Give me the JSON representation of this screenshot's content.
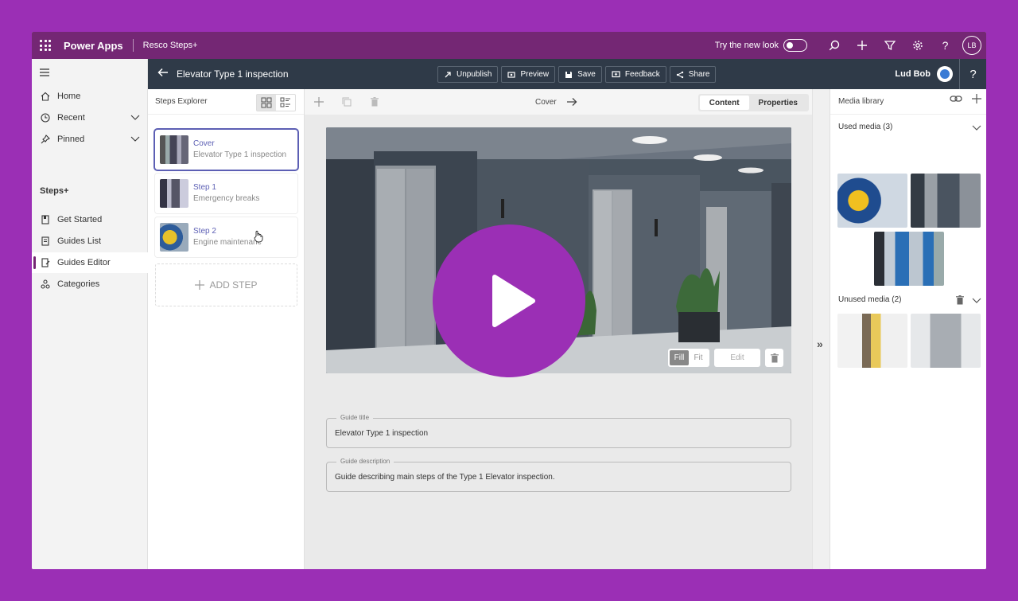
{
  "suite": {
    "app_name": "Power Apps",
    "env_name": "Resco Steps+",
    "try_new_look": "Try the new look",
    "avatar_initials": "LB"
  },
  "nav": {
    "items": [
      {
        "label": "Home"
      },
      {
        "label": "Recent"
      },
      {
        "label": "Pinned"
      }
    ],
    "section": "Steps+",
    "section_items": [
      {
        "label": "Get Started"
      },
      {
        "label": "Guides List"
      },
      {
        "label": "Guides Editor"
      },
      {
        "label": "Categories"
      }
    ]
  },
  "command_bar": {
    "title": "Elevator Type 1 inspection",
    "buttons": [
      {
        "label": "Unpublish"
      },
      {
        "label": "Preview"
      },
      {
        "label": "Save"
      },
      {
        "label": "Feedback"
      },
      {
        "label": "Share"
      }
    ],
    "user_name": "Lud Bob",
    "help": "?"
  },
  "steps_explorer": {
    "title": "Steps Explorer",
    "steps": [
      {
        "name": "Cover",
        "subtitle": "Elevator Type 1 inspection"
      },
      {
        "name": "Step 1",
        "subtitle": "Emergency breaks"
      },
      {
        "name": "Step 2",
        "subtitle": "Engine maintenance"
      }
    ],
    "add_step": "ADD STEP"
  },
  "editor": {
    "breadcrumb": "Cover",
    "tabs": [
      "Content",
      "Properties"
    ],
    "image_mode": {
      "fill": "Fill",
      "fit": "Fit",
      "selected": "Fill"
    },
    "edit_label": "Edit",
    "guide_title_label": "Guide title",
    "guide_title": "Elevator Type 1 inspection",
    "guide_description_label": "Guide description",
    "guide_description": "Guide describing main steps of the Type 1 Elevator inspection."
  },
  "media_library": {
    "title": "Media library",
    "used_label": "Used media (3)",
    "unused_label": "Unused media (2)"
  },
  "colors": {
    "brand": "#742774",
    "accent": "#5c5fb4",
    "play_overlay": "#9b2fb5"
  }
}
